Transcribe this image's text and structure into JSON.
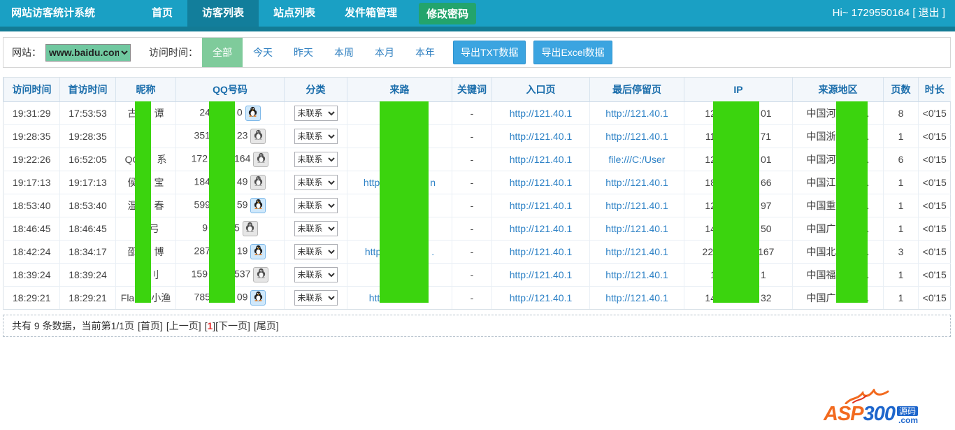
{
  "colors": {
    "nav_bg": "#1aa0c4",
    "nav_active_bg": "#127e9b",
    "nav_green_pill": "#23a46c",
    "filter_green": "#7fcb9b",
    "select_green": "#70c8a0",
    "export_blue": "#3ba4e0",
    "header_text": "#1a6dab",
    "link_blue": "#2e82c6",
    "redaction_green": "#3bd40e",
    "current_page_red": "#e53333",
    "logo_orange": "#f26a1f",
    "logo_blue": "#1e66cc"
  },
  "nav": {
    "title": "网站访客统计系统",
    "items": [
      {
        "label": "首页"
      },
      {
        "label": "访客列表",
        "active": true
      },
      {
        "label": "站点列表"
      },
      {
        "label": "发件箱管理"
      },
      {
        "label": "修改密码",
        "green": true
      }
    ],
    "greeting": "Hi~ 1729550164",
    "logout": "[ 退出 ]"
  },
  "filter": {
    "site_label": "网站：",
    "site_value": "www.baidu.com",
    "time_label": "访问时间：",
    "time_filters": [
      {
        "label": "全部",
        "active": true
      },
      {
        "label": "今天"
      },
      {
        "label": "昨天"
      },
      {
        "label": "本周"
      },
      {
        "label": "本月"
      },
      {
        "label": "本年"
      }
    ],
    "export_txt": "导出TXT数据",
    "export_excel": "导出Excel数据"
  },
  "table": {
    "headers": [
      "访问时间",
      "首访时间",
      "昵称",
      "QQ号码",
      "分类",
      "来路",
      "关键词",
      "入口页",
      "最后停留页",
      "IP",
      "来源地区",
      "页数",
      "时长"
    ],
    "rows": [
      {
        "visit": "19:31:29",
        "first": "17:53:53",
        "nick_l": "古",
        "nick_r": "谭",
        "qq_l": "24",
        "qq_r": "0",
        "qq_status": "online",
        "category": "未联系",
        "ref_l": "",
        "ref_r": "",
        "kw": "-",
        "entry": "http://121.40.1",
        "last": "http://121.40.1",
        "ip_l": "12",
        "ip_r": "01",
        "region_l": "中国河",
        "region_r": ".",
        "pages": "8",
        "dur": "<0'15"
      },
      {
        "visit": "19:28:35",
        "first": "19:28:35",
        "nick_l": "",
        "nick_r": "",
        "qq_l": "351",
        "qq_r": "23",
        "qq_status": "offline",
        "category": "未联系",
        "ref_l": "",
        "ref_r": "",
        "kw": "-",
        "entry": "http://121.40.1",
        "last": "http://121.40.1",
        "ip_l": "11",
        "ip_r": "71",
        "region_l": "中国浙",
        "region_r": ".",
        "pages": "1",
        "dur": "<0'15"
      },
      {
        "visit": "19:22:26",
        "first": "16:52:05",
        "nick_l": "QQ",
        "nick_r": "系",
        "qq_l": "172",
        "qq_r": "164",
        "qq_status": "offline",
        "category": "未联系",
        "ref_l": "",
        "ref_r": "",
        "kw": "-",
        "entry": "http://121.40.1",
        "last": "file:///C:/User",
        "ip_l": "12",
        "ip_r": "01",
        "region_l": "中国河",
        "region_r": ".",
        "pages": "6",
        "dur": "<0'15"
      },
      {
        "visit": "19:17:13",
        "first": "19:17:13",
        "nick_l": "侯",
        "nick_r": "宝",
        "qq_l": "184",
        "qq_r": "49",
        "qq_status": "offline",
        "category": "未联系",
        "ref_l": "http",
        "ref_r": "n",
        "kw": "-",
        "entry": "http://121.40.1",
        "last": "http://121.40.1",
        "ip_l": "18",
        "ip_r": "66",
        "region_l": "中国江",
        "region_r": ".",
        "pages": "1",
        "dur": "<0'15"
      },
      {
        "visit": "18:53:40",
        "first": "18:53:40",
        "nick_l": "温",
        "nick_r": "春",
        "qq_l": "599",
        "qq_r": "59",
        "qq_status": "online",
        "category": "未联系",
        "ref_l": "",
        "ref_r": "",
        "kw": "-",
        "entry": "http://121.40.1",
        "last": "http://121.40.1",
        "ip_l": "12",
        "ip_r": "97",
        "region_l": "中国重",
        "region_r": ".",
        "pages": "1",
        "dur": "<0'15"
      },
      {
        "visit": "18:46:45",
        "first": "18:46:45",
        "nick_l": "",
        "nick_r": "弓",
        "qq_l": "9",
        "qq_r": "5",
        "qq_status": "offline",
        "category": "未联系",
        "ref_l": "",
        "ref_r": "",
        "kw": "-",
        "entry": "http://121.40.1",
        "last": "http://121.40.1",
        "ip_l": "14",
        "ip_r": "50",
        "region_l": "中国广",
        "region_r": ".",
        "pages": "1",
        "dur": "<0'15"
      },
      {
        "visit": "18:42:24",
        "first": "18:34:17",
        "nick_l": "邵",
        "nick_r": "博",
        "qq_l": "287",
        "qq_r": "19",
        "qq_status": "online",
        "category": "未联系",
        "ref_l": "http",
        "ref_r": ".",
        "kw": "-",
        "entry": "http://121.40.1",
        "last": "http://121.40.1",
        "ip_l": "22",
        "ip_r": "167",
        "region_l": "中国北",
        "region_r": ".",
        "pages": "3",
        "dur": "<0'15"
      },
      {
        "visit": "18:39:24",
        "first": "18:39:24",
        "nick_l": "",
        "nick_r": "刂",
        "qq_l": "159",
        "qq_r": "537",
        "qq_status": "offline",
        "category": "未联系",
        "ref_l": "",
        "ref_r": "",
        "kw": "-",
        "entry": "http://121.40.1",
        "last": "http://121.40.1",
        "ip_l": "1",
        "ip_r": "1",
        "region_l": "中国福",
        "region_r": ".",
        "pages": "1",
        "dur": "<0'15"
      },
      {
        "visit": "18:29:21",
        "first": "18:29:21",
        "nick_l": "Fla",
        "nick_r": "小渔",
        "qq_l": "785",
        "qq_r": "09",
        "qq_status": "online",
        "category": "未联系",
        "ref_l": "htt",
        "ref_r": "",
        "kw": "-",
        "entry": "http://121.40.1",
        "last": "http://121.40.1",
        "ip_l": "14",
        "ip_r": "32",
        "region_l": "中国广",
        "region_r": ".",
        "pages": "1",
        "dur": "<0'15"
      }
    ]
  },
  "pagination": {
    "summary": "共有 9 条数据，当前第1/1页",
    "first": "[首页]",
    "prev": "[上一页]",
    "bracket_open": "[",
    "current": "1",
    "bracket_close": "]",
    "next": "[下一页]",
    "last": "[尾页]"
  },
  "logo": {
    "asp": "ASP",
    "num": "300",
    "yuanma": "源码",
    "com": ".com"
  }
}
